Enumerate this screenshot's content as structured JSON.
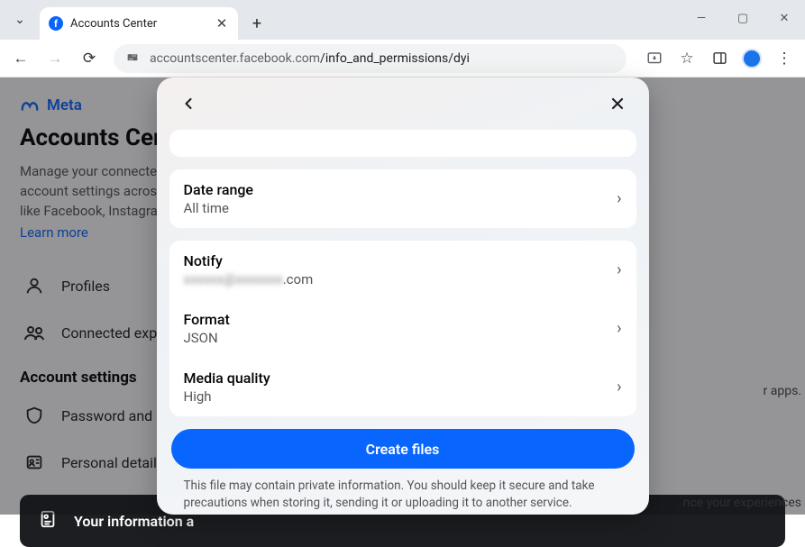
{
  "browser": {
    "tab_title": "Accounts Center",
    "url_host": "accountscenter.facebook.com",
    "url_path": "/info_and_permissions/dyi"
  },
  "page": {
    "brand": "Meta",
    "title": "Accounts Center",
    "desc_l1": "Manage your connected ex",
    "desc_l2": "account settings across Me",
    "desc_l3": "like Facebook, Instagram a",
    "learn_more": "Learn more",
    "nav": {
      "profiles": "Profiles",
      "connected": "Connected experi"
    },
    "section_account_settings": "Account settings",
    "nav2": {
      "password": "Password and sec",
      "personal": "Personal details"
    },
    "info_card": "Your information a",
    "right_hint1": "r apps.",
    "right_hint2": "nce your experiences"
  },
  "modal": {
    "rows": {
      "date_range": {
        "label": "Date range",
        "value": "All time"
      },
      "notify": {
        "label": "Notify",
        "value_prefix": "xxxxxx",
        "value_mid": "@xxxxxxx",
        "value_suffix": ".com"
      },
      "format": {
        "label": "Format",
        "value": "JSON"
      },
      "media_quality": {
        "label": "Media quality",
        "value": "High"
      }
    },
    "primary_button": "Create files",
    "disclaimer": "This file may contain private information. You should keep it secure and take precautions when storing it, sending it or uploading it to another service."
  }
}
